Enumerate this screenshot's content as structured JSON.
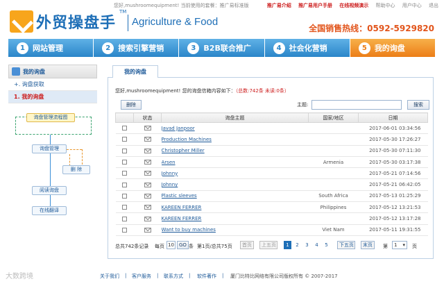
{
  "topbar": {
    "greeting": "您好,mushroomequipment! 当前使用的套餐：推广易标准版",
    "links": [
      {
        "label": "推广易介绍",
        "highlight": true
      },
      {
        "label": "推广易用户手册",
        "highlight": true
      },
      {
        "label": "在线视频演示",
        "highlight": true
      },
      {
        "label": "帮助中心",
        "highlight": false
      },
      {
        "label": "用户中心",
        "highlight": false
      },
      {
        "label": "退出",
        "highlight": false
      }
    ]
  },
  "brand": {
    "name_cn": "外贸操盘手",
    "tm": "TM",
    "name_en": "Agriculture & Food",
    "logo_icon": "checkmark-logo-icon"
  },
  "hotline": "全国销售热线：0592-5929820",
  "nav": [
    {
      "num": "1",
      "label": "网站管理"
    },
    {
      "num": "2",
      "label": "搜索引擎营销"
    },
    {
      "num": "3",
      "label": "B2B联合推广"
    },
    {
      "num": "4",
      "label": "社会化营销"
    },
    {
      "num": "5",
      "label": "我的询盘"
    }
  ],
  "nav_active": 4,
  "sidebar": {
    "heading": "我的询盘",
    "items": [
      {
        "label": "+. 询盘获取",
        "active": false
      },
      {
        "label": "1. 我的询盘",
        "active": true
      }
    ]
  },
  "flow": {
    "title": "询盘管理流程图",
    "steps": [
      "询盘管理",
      "删 除",
      "阅读询盘",
      "在线翻译"
    ]
  },
  "panel": {
    "tab_label": "我的询盘",
    "summary_prefix": "您好,mushroomequipment! 您的询盘信箱内容如下：",
    "summary_counts": "（总数:742条  未读:0条）",
    "delete_label": "删除",
    "keyword_label": "主题:",
    "keyword_value": "",
    "search_label": "搜索"
  },
  "table": {
    "headers": [
      "",
      "状态",
      "询盘主题",
      "国家/地区",
      "日期"
    ],
    "rows": [
      {
        "subject": "Javad Janpoor",
        "region": "",
        "date": "2017-06-01 03:34:56"
      },
      {
        "subject": "Production Machines",
        "region": "",
        "date": "2017-05-30 17:26:27"
      },
      {
        "subject": "Christopher Miller",
        "region": "",
        "date": "2017-05-30 07:11:30"
      },
      {
        "subject": "Arsen",
        "region": "Armenia",
        "date": "2017-05-30 03:17:38"
      },
      {
        "subject": "Johnny",
        "region": "",
        "date": "2017-05-21 07:14:56"
      },
      {
        "subject": "Johnny",
        "region": "",
        "date": "2017-05-21 06:42:05"
      },
      {
        "subject": "Plastic sleeves",
        "region": "South Africa",
        "date": "2017-05-13 01:25:29"
      },
      {
        "subject": "KAREEN FERRER",
        "region": "Philippines",
        "date": "2017-05-12 13:21:53"
      },
      {
        "subject": "KAREEN FERRER",
        "region": "",
        "date": "2017-05-12 13:17:28"
      },
      {
        "subject": "Want to buy machines",
        "region": "Viet Nam",
        "date": "2017-05-11 19:31:55"
      }
    ]
  },
  "pager": {
    "total": "总共742条记录",
    "per_page_label": "每页",
    "per_page_value": "10",
    "go_label": "GO",
    "unit": "条",
    "page_info": "第1页/总共75页",
    "first": "首页",
    "prev5": "上五页",
    "pages": [
      "1",
      "2",
      "3",
      "4",
      "5"
    ],
    "current_page": "1",
    "next5": "下五页",
    "last": "末页",
    "jump_prefix": "第",
    "jump_value": "1",
    "jump_suffix": "页"
  },
  "footer": {
    "links": [
      "关于我们",
      "客户服务",
      "联系方式",
      "软件著作"
    ],
    "copyright": "厦门比特比网络有限公司版权所有 © 2007-2017"
  },
  "watermark": "大数跨境"
}
